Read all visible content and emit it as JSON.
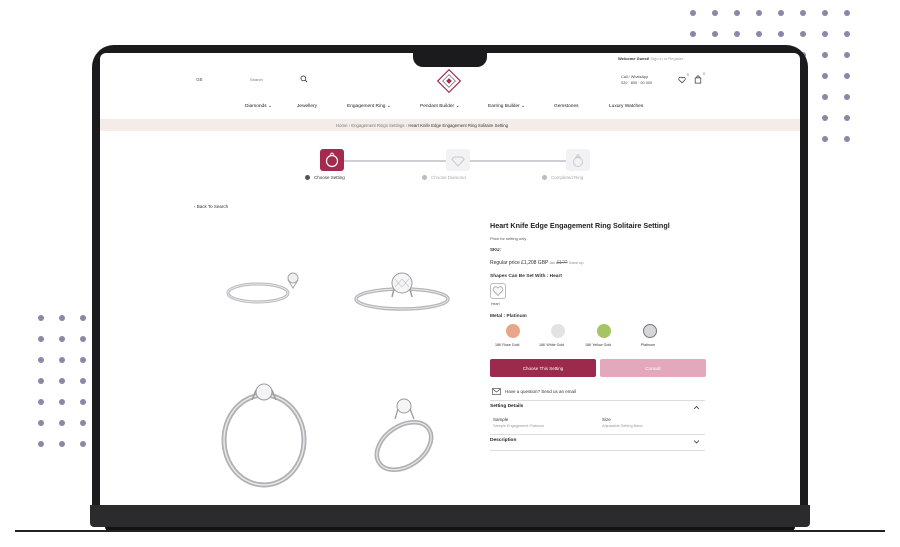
{
  "header": {
    "welcome_prefix": "Welcome Guest!",
    "welcome_links": "Sign in or Register",
    "currency": "GB",
    "search_placeholder": "Search",
    "store_line1": "Call / WhatsApp",
    "store_line2": "020 · 800 · 00 000",
    "wishlist_count": "0",
    "cart_count": "0"
  },
  "nav": {
    "items": [
      "Diamonds ⌄",
      "Jewellery",
      "Engagement Ring ⌄",
      "Pendant Builder ⌄",
      "Earring Builder ⌄",
      "Gemstones",
      "Luxury Watches"
    ]
  },
  "breadcrumb": {
    "home": "Home",
    "parent": "Engagement Rings Settings",
    "current": "Heart Knife Edge Engagement Ring Solitaire Setting"
  },
  "stepper": {
    "steps": [
      "Choose Setting",
      "Choose Diamond",
      "Completed Ring"
    ]
  },
  "back_link": "‹ Back To Search",
  "product": {
    "title": "Heart Knife Edge Engagement Ring Solitaire Settingl",
    "price_for": "Price for setting only",
    "sku": "SKU:",
    "regular_price": "Regular price £1,208 GBP",
    "old_price_prefix": "tax",
    "old_price": "£1??",
    "save": "Save up",
    "shapes_label": "Shapes Can Be Set With : Heart",
    "shape_caption": "Heart",
    "metal_label": "Metal : Platinum",
    "metals": [
      {
        "name": "18K Rose Gold",
        "color": "#e9a58a"
      },
      {
        "name": "18K White Gold",
        "color": "#e3e3e6"
      },
      {
        "name": "18K Yellow Gold",
        "color": "#a7c462"
      },
      {
        "name": "Platinum",
        "color": "#d6d6da"
      }
    ],
    "choose_btn": "Choose This Setting",
    "secondary_btn": "Consult",
    "appointment_text": "Have a question? Send us an email",
    "setting_details_title": "Setting Details",
    "details": [
      {
        "label": "Sample",
        "value": "Sample Engagement Platinum"
      },
      {
        "label": "Size",
        "value": "Adjustable Setting Band"
      }
    ],
    "description_title": "Description"
  },
  "colors": {
    "accent": "#9c2a4c",
    "accent_light": "#e3a8bb",
    "breadcrumb_bg": "#f3ece9"
  }
}
